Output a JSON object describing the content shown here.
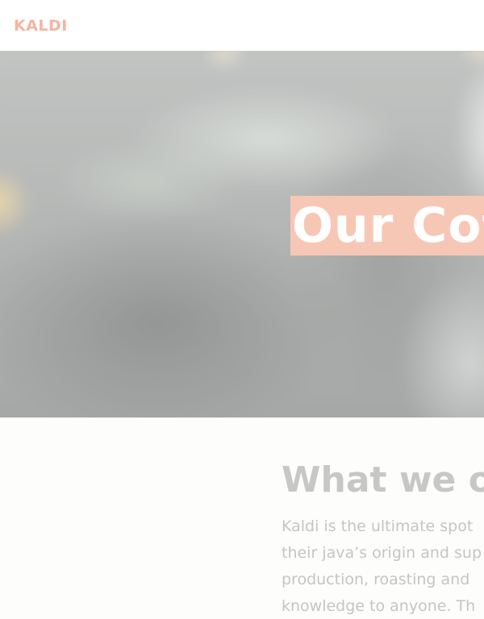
{
  "navbar": {
    "logo_text": "KALDI"
  },
  "hero": {
    "title": "Our Cof",
    "background_image": "blurred-coffee-shop-photo"
  },
  "about": {
    "heading": "What we o",
    "paragraph_lines": [
      "Kaldi is the ultimate spot",
      "their java’s origin and sup",
      "production, roasting and",
      "knowledge to anyone. Th"
    ]
  },
  "colors": {
    "accent": "#f7c7b6",
    "logo": "#f5b5a0",
    "heading": "#c7c7c5",
    "body_text": "#c5c5c3",
    "page_background": "#fdfdfb"
  }
}
